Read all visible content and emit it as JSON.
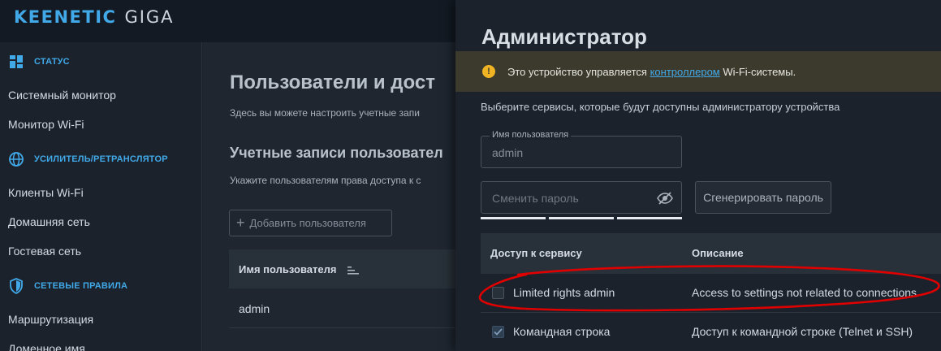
{
  "brand": {
    "name": "KEENETIC",
    "model": "GIGA"
  },
  "sidebar": {
    "sections": [
      {
        "label": "СТАТУС",
        "icon": "dashboard-icon"
      },
      {
        "label": "УСИЛИТЕЛЬ/РЕТРАНСЛЯТОР",
        "icon": "globe-icon"
      },
      {
        "label": "СЕТЕВЫЕ ПРАВИЛА",
        "icon": "shield-icon"
      }
    ],
    "items": [
      "Системный монитор",
      "Монитор Wi-Fi",
      "Клиенты Wi-Fi",
      "Домашняя сеть",
      "Гостевая сеть",
      "Маршрутизация",
      "Доменное имя"
    ]
  },
  "main": {
    "title": "Пользователи и дост",
    "description": "Здесь вы можете настроить учетные запи",
    "subtitle": "Учетные записи пользовател",
    "description2": "Укажите пользователям права доступа к с",
    "add_button": "Добавить пользователя",
    "table": {
      "header": "Имя пользователя",
      "rows": [
        "admin"
      ]
    }
  },
  "panel": {
    "title": "Администратор",
    "notice": {
      "before": "Это устройство управляется ",
      "link": "контроллером",
      "after": " Wi-Fi-системы."
    },
    "intro": "Выберите сервисы, которые будут доступны администратору устройства",
    "username_label": "Имя пользователя",
    "username_value": "admin",
    "password_placeholder": "Сменить пароль",
    "generate_button": "Сгенерировать пароль",
    "access_table": {
      "col_service": "Доступ к сервису",
      "col_description": "Описание",
      "rows": [
        {
          "name": "Limited rights admin",
          "description": "Access to settings not related to connections",
          "checked": false
        },
        {
          "name": "Командная строка",
          "description": "Доступ к командной строке (Telnet и SSH)",
          "checked": true
        }
      ]
    }
  },
  "colors": {
    "accent": "#41a9e8",
    "warning": "#f0b323",
    "annotation": "#e00000"
  }
}
